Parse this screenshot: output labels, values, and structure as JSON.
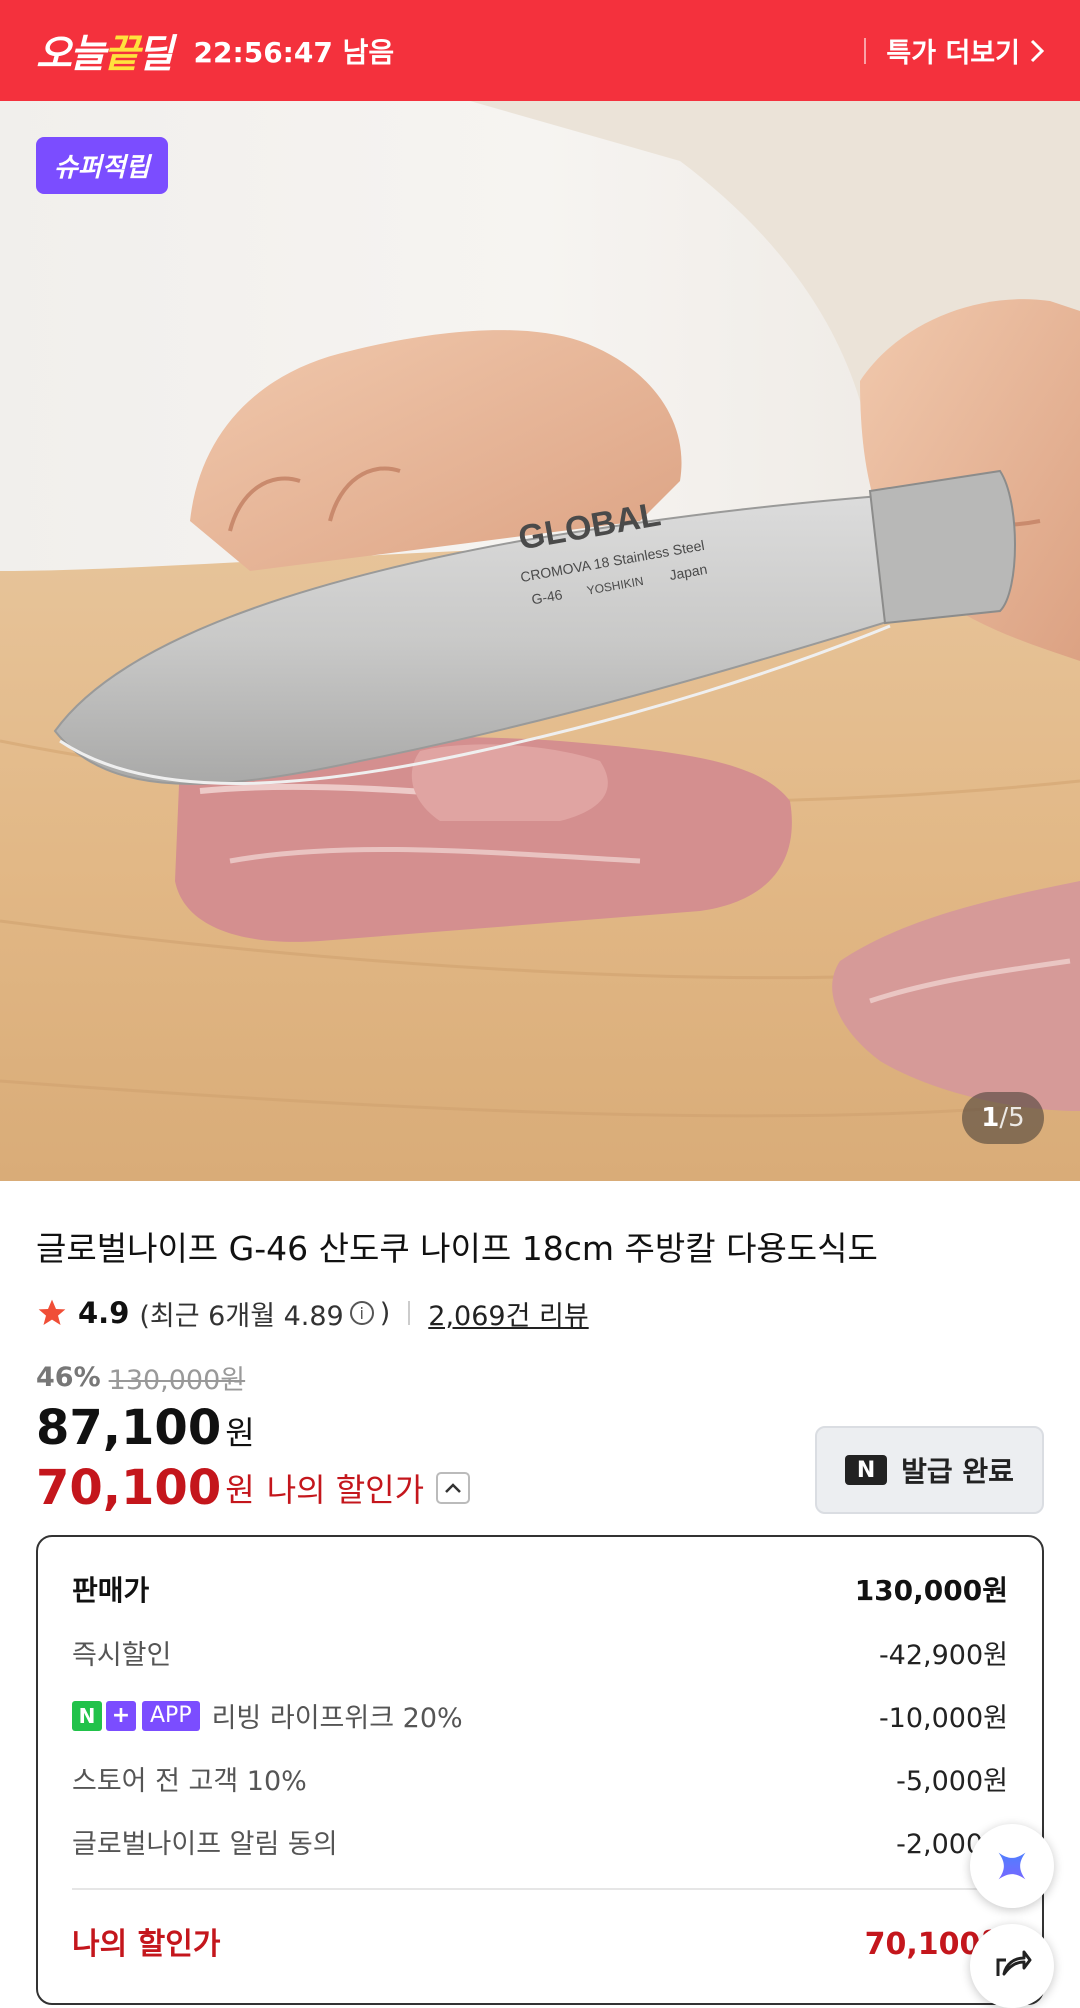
{
  "deal_bar": {
    "logo_part1": "오늘",
    "logo_highlight": "끝",
    "logo_part2": "딜",
    "timer": "22:56:47 남음",
    "more_label": "특가 더보기",
    "bg_color": "#f4313d",
    "highlight_color": "#ffe23d"
  },
  "hero": {
    "badge": "슈퍼적립",
    "counter_current": "1",
    "counter_total": "/5",
    "blade_text_brand": "GLOBAL",
    "blade_text_steel": "CROMOVA 18 Stainless Steel",
    "blade_text_model": "G-46",
    "blade_text_maker": "YOSHIKIN",
    "blade_text_origin": "Japan"
  },
  "product": {
    "title": "글로벌나이프 G-46 산도쿠 나이프 18cm 주방칼 다용도식도",
    "rating": "4.9",
    "recent_rating_prefix": "(최근 6개월 4.89",
    "recent_rating_suffix": ")",
    "review_count": "2,069건 리뷰",
    "discount_percent": "46%",
    "original_price": "130,000원",
    "sale_price": "87,100",
    "sale_unit": "원",
    "my_price": "70,100",
    "my_price_unit": "원",
    "my_price_label": "나의 할인가",
    "accent_color": "#c4161c"
  },
  "coupon": {
    "icon": "N",
    "label": "발급 완료"
  },
  "breakdown": {
    "rows": [
      {
        "label": "판매가",
        "value": "130,000원"
      },
      {
        "label": "즉시할인",
        "value": "-42,900원"
      },
      {
        "chip_n": "N",
        "chip_plus": "+",
        "chip_app": "APP",
        "label": "리빙 라이프위크 20%",
        "value": "-10,000원"
      },
      {
        "label": "스토어 전 고객 10%",
        "value": "-5,000원"
      },
      {
        "label": "글로벌나이프 알림 동의",
        "value": "-2,000원"
      }
    ],
    "total_label": "나의 할인가",
    "total_value": "70,100원"
  },
  "floating": {
    "ai_icon": "sparkle-icon",
    "share_icon": "share-icon"
  }
}
